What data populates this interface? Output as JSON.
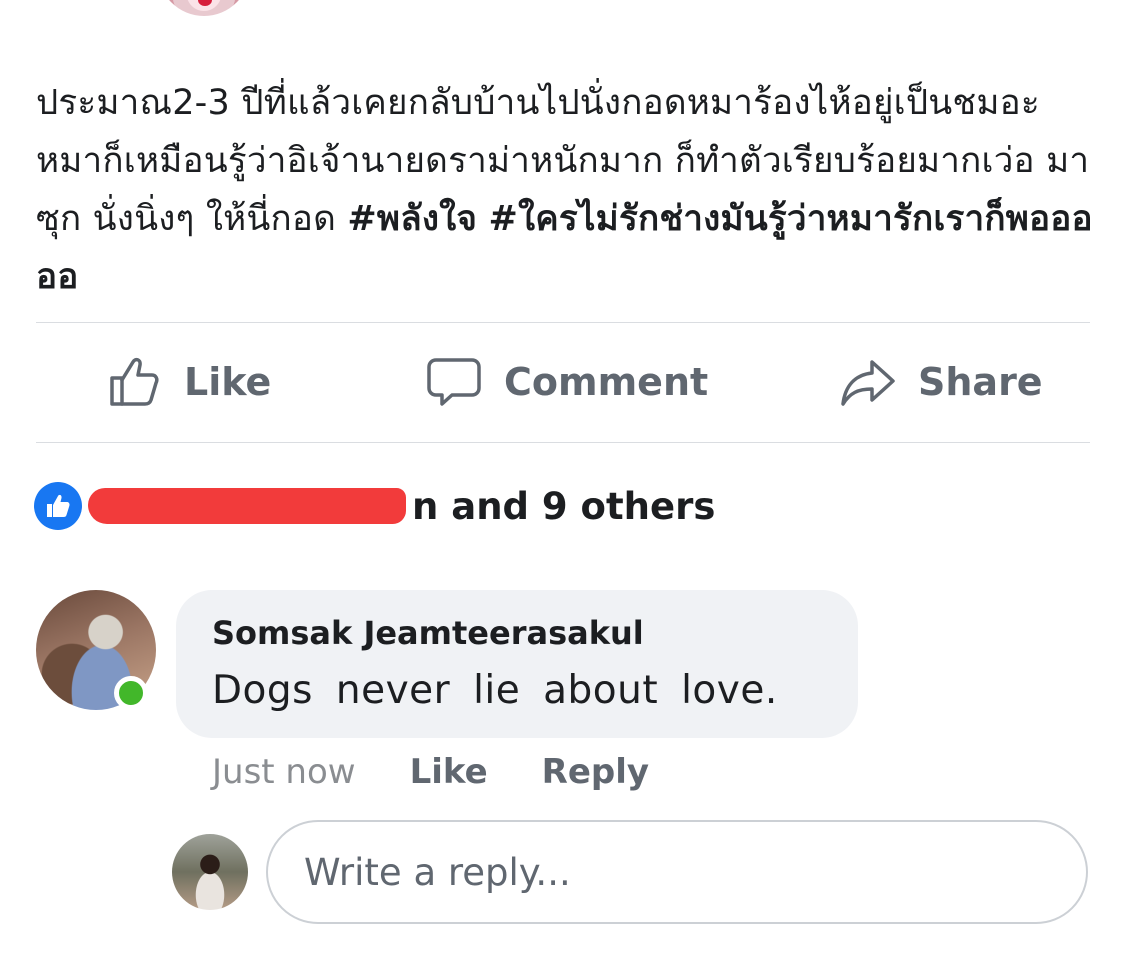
{
  "post": {
    "text": "ประมาณ2-3 ปีที่แล้วเคยกลับบ้านไปนั่งกอดหมาร้องไห้อยู่เป็นชมอะ หมาก็เหมือนรู้ว่าอิเจ้านายดราม่าหนักมาก ก็ทำตัวเรียบร้อยมากเว่อ มาซุก นั่งนิ่งๆ ให้นี่กอด",
    "hashtags": [
      "#พลังใจ",
      "#ใครไม่รักช่างมันรู้ว่าหมารักเราก็พอออออ"
    ]
  },
  "actions": {
    "like_label": "Like",
    "comment_label": "Comment",
    "share_label": "Share"
  },
  "reactions": {
    "visible_tail": "n",
    "count_text": "and 9 others"
  },
  "comment": {
    "author": "Somsak Jeamteerasakul",
    "text": "Dogs never lie about love.",
    "time": "Just now",
    "like_label": "Like",
    "reply_label": "Reply"
  },
  "reply": {
    "placeholder": "Write a reply..."
  },
  "colors": {
    "facebook_blue": "#1877f2",
    "online_green": "#42b72a",
    "redaction_red": "#f23b3b",
    "bubble_gray": "#f0f2f5",
    "action_gray": "#606770"
  },
  "icons": {
    "like": "thumbs-up-outline-icon",
    "comment": "speech-bubble-icon",
    "share": "share-arrow-icon",
    "reaction": "like-reaction-icon"
  }
}
